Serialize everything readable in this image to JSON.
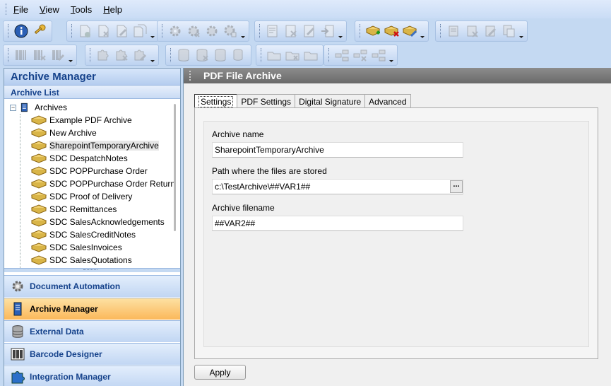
{
  "menu": {
    "items": [
      {
        "key": "F",
        "rest": "ile"
      },
      {
        "key": "V",
        "rest": "iew"
      },
      {
        "key": "T",
        "rest": "ools"
      },
      {
        "key": "H",
        "rest": "elp"
      }
    ]
  },
  "left_panel": {
    "title": "Archive Manager",
    "subtitle": "Archive List",
    "tree": {
      "root_label": "Archives",
      "items": [
        "Example PDF Archive",
        "New Archive",
        "SharepointTemporaryArchive",
        "SDC DespatchNotes",
        "SDC POPPurchase Order",
        "SDC POPPurchase Order Return",
        "SDC Proof of Delivery",
        "SDC Remittances",
        "SDC SalesAcknowledgements",
        "SDC SalesCreditNotes",
        "SDC SalesInvoices",
        "SDC SalesQuotations"
      ],
      "selected_index": 2
    },
    "nav": [
      {
        "label": "Document Automation",
        "icon": "gear-icon"
      },
      {
        "label": "Archive Manager",
        "icon": "archive-server-icon",
        "active": true
      },
      {
        "label": "External Data",
        "icon": "database-icon"
      },
      {
        "label": "Barcode Designer",
        "icon": "barcode-icon"
      },
      {
        "label": "Integration Manager",
        "icon": "puzzle-icon"
      }
    ]
  },
  "right_panel": {
    "title": "PDF File Archive",
    "tabs": [
      "Settings",
      "PDF Settings",
      "Digital Signature",
      "Advanced"
    ],
    "active_tab": 0,
    "fields": {
      "archive_name_label": "Archive name",
      "archive_name_value": "SharepointTemporaryArchive",
      "path_label": "Path where the files are stored",
      "path_value": "c:\\TestArchive\\##VAR1##",
      "browse_label": "...",
      "filename_label": "Archive filename",
      "filename_value": "##VAR2##"
    },
    "apply_label": "Apply"
  },
  "colors": {
    "header_text": "#15428b",
    "active_nav": "#fbb85a",
    "toolbar_bg": "#c4d9f2"
  }
}
